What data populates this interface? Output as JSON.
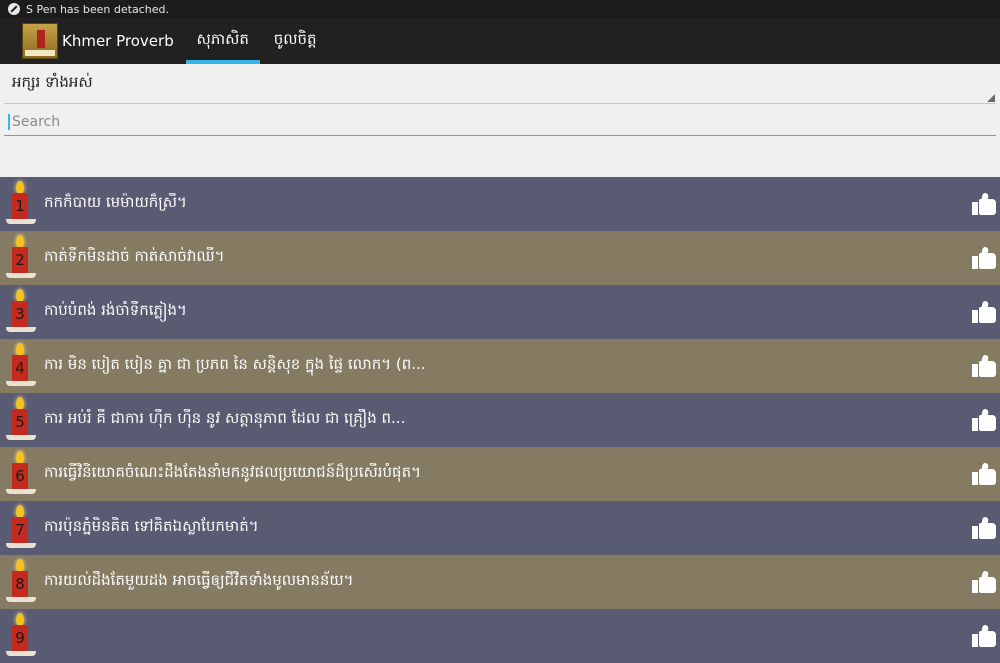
{
  "status_bar": {
    "message": "S Pen has been detached."
  },
  "action_bar": {
    "app_title": "Khmer Proverb",
    "tabs": [
      {
        "label": "សុភាសិត",
        "active": true
      },
      {
        "label": "ចូលចិត្ត",
        "active": false
      }
    ]
  },
  "filter": {
    "dropdown_value": "អក្សរ ទាំងអស់",
    "search_placeholder": "Search"
  },
  "proverbs": [
    {
      "number": "1",
      "text": "កកក៏បាយ មេម៉ាយក៏ស្រី។"
    },
    {
      "number": "2",
      "text": "កាត់ទឹកមិនដាច់ កាត់សាច់វាឈឺ។"
    },
    {
      "number": "3",
      "text": "កាប់បំពង់ រង់ចាំទឹកភ្លៀង។"
    },
    {
      "number": "4",
      "text": "ការ មិន បៀត បៀន គ្នា ជា ប្រភព នៃ សន្តិសុខ ក្នុង ផ្ទៃ លោក។ (ព..."
    },
    {
      "number": "5",
      "text": "ការ អប់រំ គឺ ជាការ ហ៊ឹក ហ៊ឺន នូវ សត្តានុភាព ដែល ជា គ្រឿង ព..."
    },
    {
      "number": "6",
      "text": "ការធ្វើវិនិយោគចំណេះដឹងតែងនាំមកនូវផលប្រយោជន៍ដ៏ប្រសើរបំផុត។"
    },
    {
      "number": "7",
      "text": "ការប៉ុនភ្នំមិនគិត ទៅគិតឯស្លាបែកមាត់។"
    },
    {
      "number": "8",
      "text": "ការយល់ដឹងតែមួយដង អាចធ្វើឲ្យជីវិតទាំងមូលមានន័យ។"
    },
    {
      "number": "9",
      "text": ""
    }
  ],
  "colors": {
    "row_dark": "#595b73",
    "row_tan": "#857a62",
    "accent": "#33b5e5",
    "action_bar": "#212121"
  },
  "icons": {
    "status": "pen-icon",
    "row_left": "candle-icon",
    "row_right": "thumbs-up-icon"
  }
}
